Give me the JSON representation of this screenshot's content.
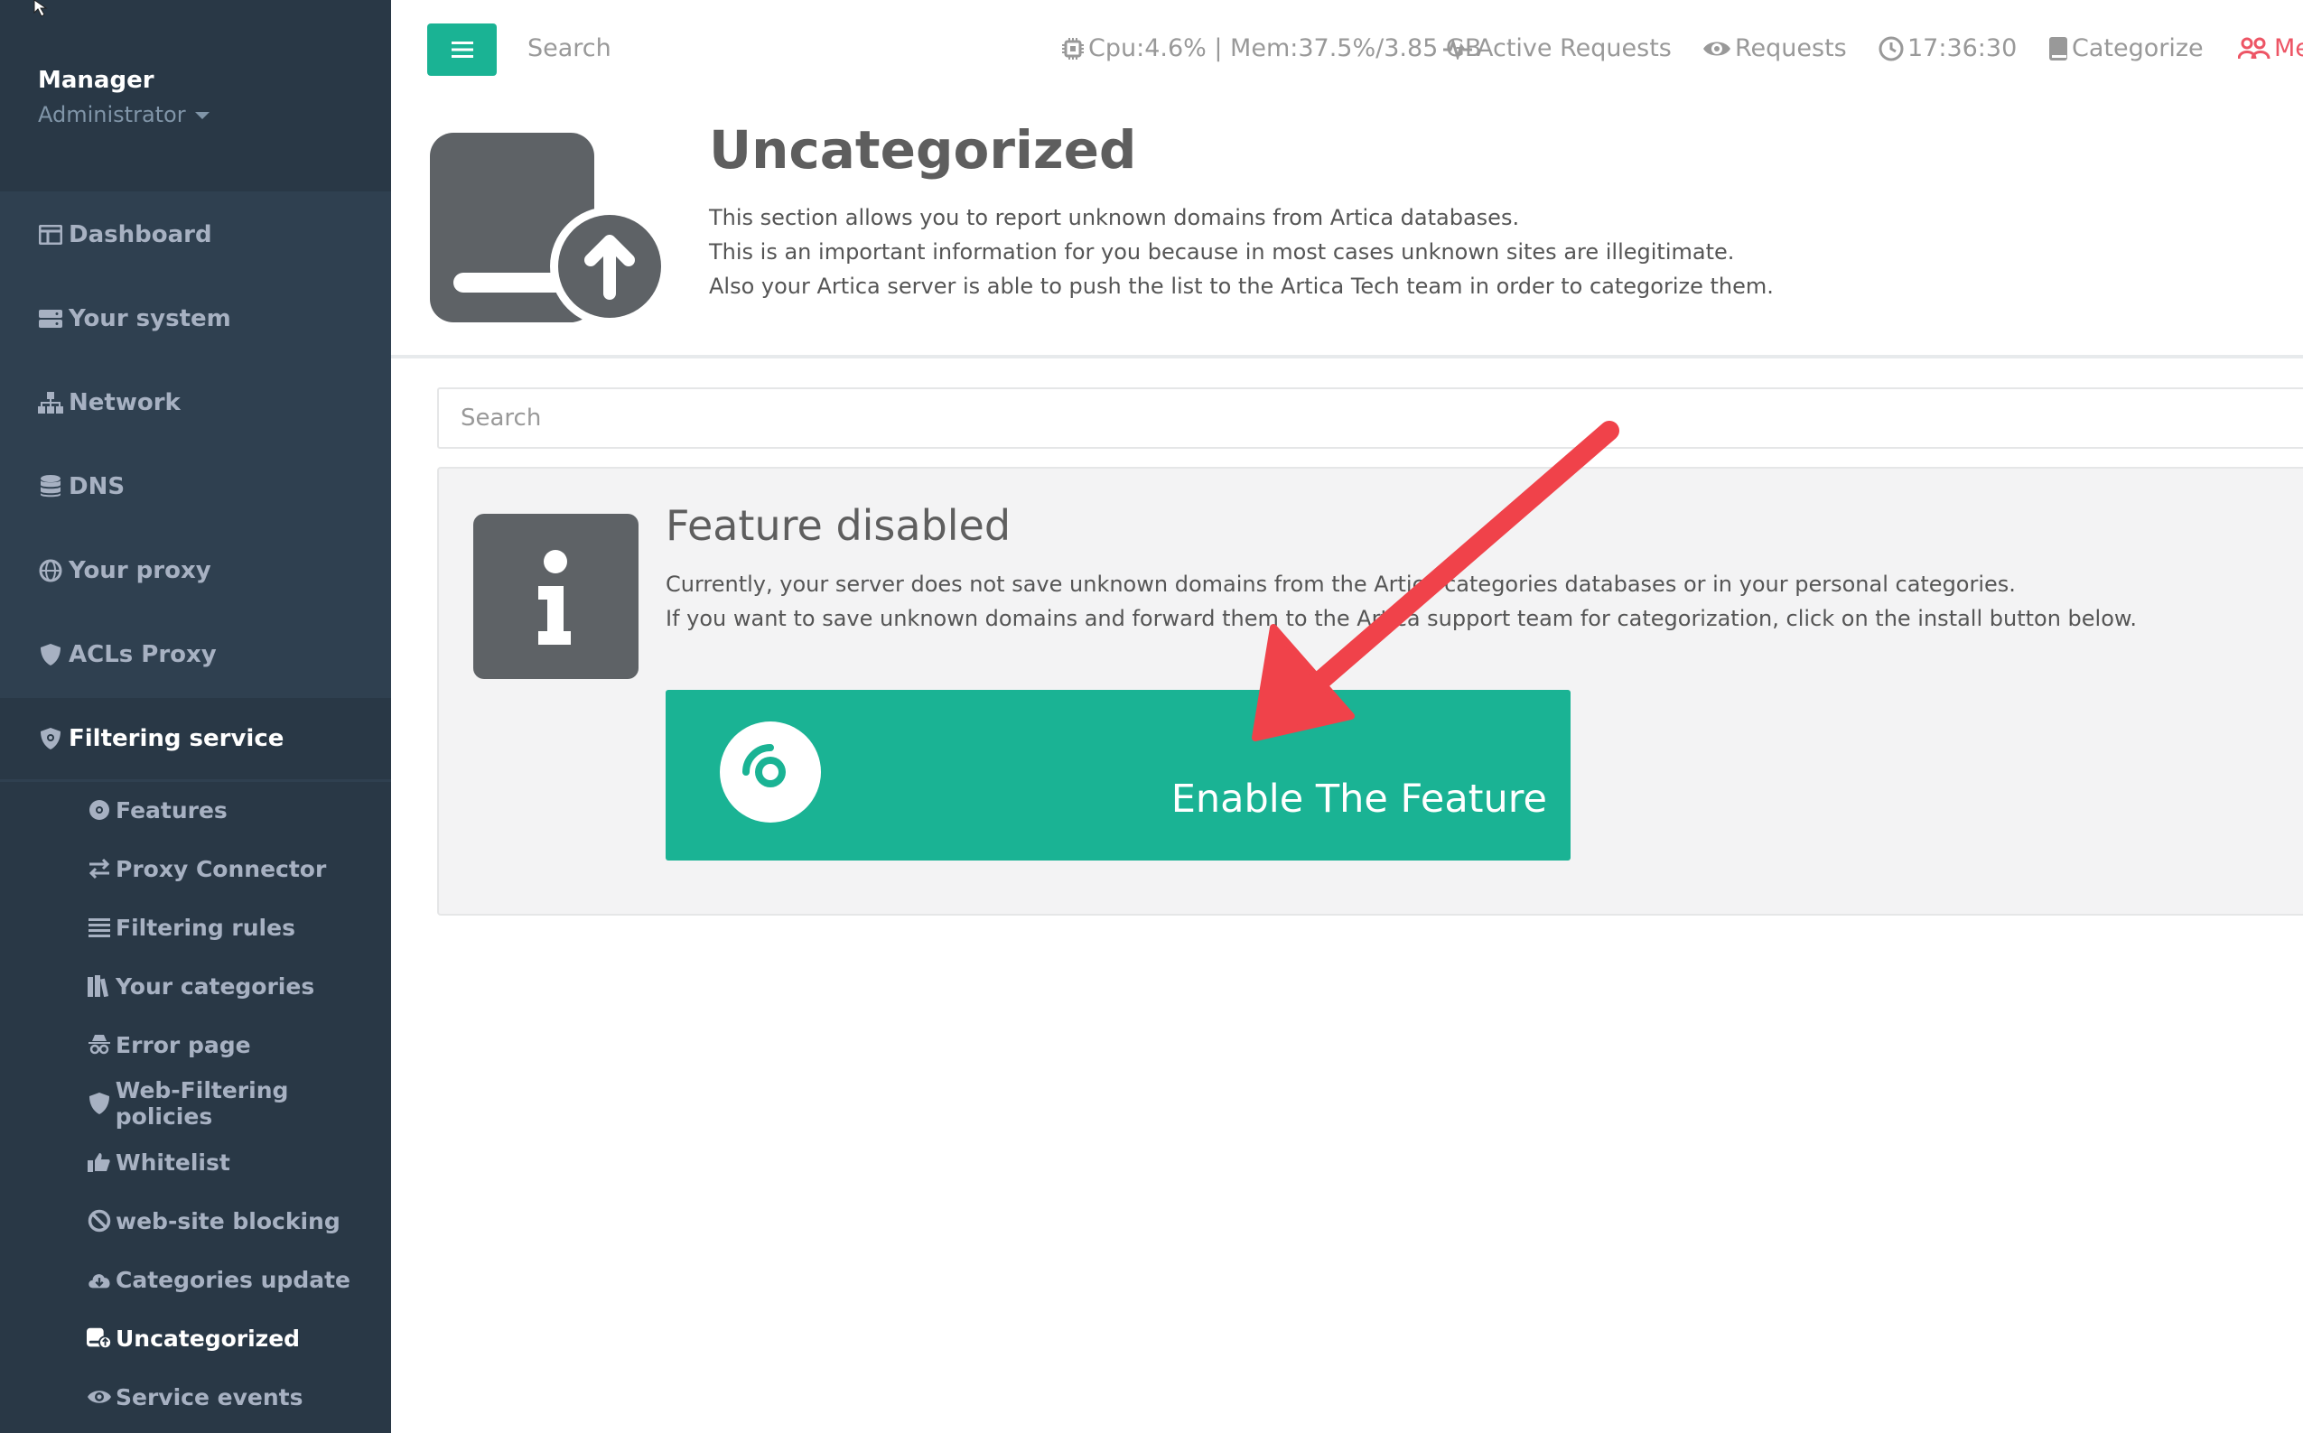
{
  "sidebar": {
    "user_name": "Manager",
    "user_role": "Administrator",
    "nav": [
      {
        "label": "Dashboard",
        "icon": "dashboard-icon"
      },
      {
        "label": "Your system",
        "icon": "server-icon"
      },
      {
        "label": "Network",
        "icon": "network-icon"
      },
      {
        "label": "DNS",
        "icon": "database-icon"
      },
      {
        "label": "Your proxy",
        "icon": "globe-icon"
      },
      {
        "label": "ACLs Proxy",
        "icon": "shield-icon"
      },
      {
        "label": "Filtering service",
        "icon": "shield-gear-icon"
      }
    ],
    "submenu": [
      {
        "label": "Features",
        "icon": "disc-icon"
      },
      {
        "label": "Proxy Connector",
        "icon": "exchange-icon"
      },
      {
        "label": "Filtering rules",
        "icon": "list-icon"
      },
      {
        "label": "Your categories",
        "icon": "books-icon"
      },
      {
        "label": "Error page",
        "icon": "spy-icon"
      },
      {
        "label": "Web-Filtering policies",
        "icon": "shield-icon"
      },
      {
        "label": "Whitelist",
        "icon": "thumbs-up-icon"
      },
      {
        "label": "web-site blocking",
        "icon": "ban-icon"
      },
      {
        "label": "Categories update",
        "icon": "cloud-download-icon"
      },
      {
        "label": "Uncategorized",
        "icon": "drive-upload-icon"
      },
      {
        "label": "Service events",
        "icon": "eye-icon"
      }
    ]
  },
  "topbar": {
    "search_placeholder": "Search",
    "stats": "Cpu:4.6% | Mem:37.5%/3.85 GB",
    "active_requests": "Active Requests",
    "requests": "Requests",
    "time": "17:36:30",
    "categorize": "Categorize",
    "members_partial": "Me"
  },
  "page": {
    "title": "Uncategorized",
    "description": [
      "This section allows you to report unknown domains from Artica databases.",
      "This is an important information for you because in most cases unknown sites are illegitimate.",
      "Also your Artica server is able to push the list to the Artica Tech team in order to categorize them."
    ],
    "search_placeholder": "Search"
  },
  "feature": {
    "title": "Feature disabled",
    "description": [
      "Currently, your server does not save unknown domains from the Artica categories databases or in your personal categories.",
      "If you want to save unknown domains and forward them to the Artica support team for categorization, click on the install button below."
    ],
    "button_label": "Enable The Feature"
  },
  "colors": {
    "sidebar_bg": "#2f4050",
    "sidebar_dark": "#293846",
    "accent": "#1ab394",
    "arrow": "#f0424a"
  }
}
